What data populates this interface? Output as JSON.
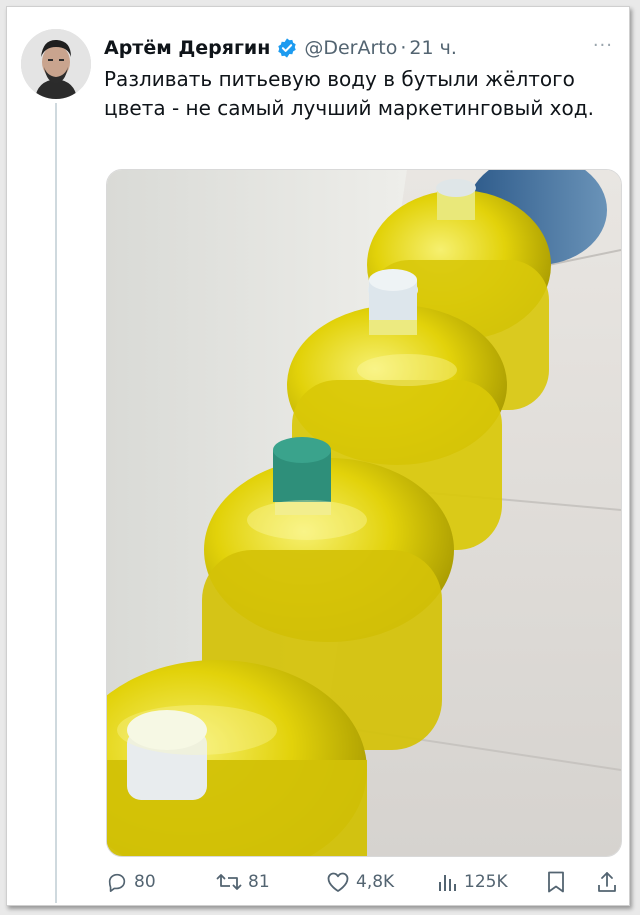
{
  "tweet": {
    "author_name": "Артём Дерягин",
    "handle": "@DerArto",
    "separator": "·",
    "time": "21 ч.",
    "more": "···",
    "text": "Разливать питьевую воду в бутыли жёлтого цвета - не самый лучший маркетинговый ход."
  },
  "metrics": {
    "replies": "80",
    "retweets": "81",
    "likes": "4,8K",
    "views": "125K"
  },
  "colors": {
    "verified": "#1d9bf0",
    "muted": "#536471",
    "text": "#0f1419"
  },
  "icons": [
    "reply-icon",
    "retweet-icon",
    "like-icon",
    "views-icon",
    "bookmark-icon",
    "share-icon",
    "verified-icon",
    "more-icon"
  ]
}
